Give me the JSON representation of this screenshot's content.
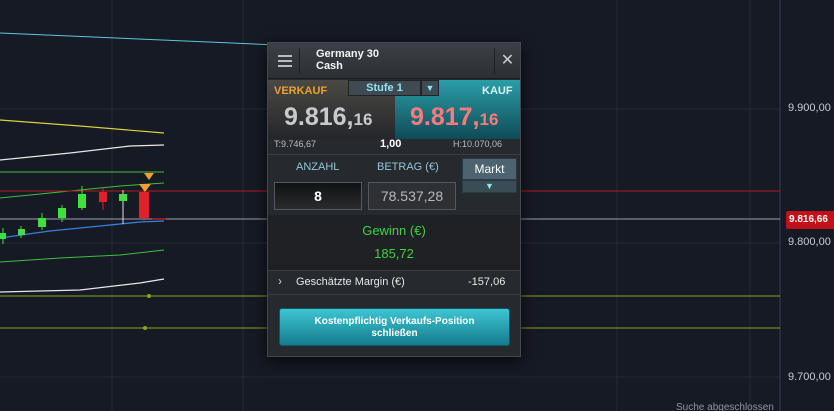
{
  "axis": {
    "labels": [
      "9.900,00",
      "9.800,00",
      "9.700,00"
    ],
    "current_price_tag": "9.816,66"
  },
  "status": {
    "market_closed_note": "Suche abgeschlossen"
  },
  "colors": {
    "background": "#161a24",
    "sell_label": "#f0a030",
    "buy_price": "#ff7b7b",
    "buy_panel": "#1e8a96",
    "gain": "#3ed43e",
    "price_tag": "#c0101a",
    "action_button": "#28a9b8"
  },
  "ticket": {
    "title_line1": "Germany 30",
    "title_line2": "Cash",
    "menu_icon": "hamburger-icon",
    "close_icon": "close-icon",
    "sell_label": "VERKAUF",
    "buy_label": "KAUF",
    "level": "Stufe 1",
    "sell_price_main": "9.816,",
    "sell_price_frac": "16",
    "buy_price_main": "9.817,",
    "buy_price_frac": "16",
    "low": "T:9.746,67",
    "spread": "1,00",
    "high": "H:10.070,06",
    "quantity_label": "ANZAHL",
    "amount_label": "BETRAG (€)",
    "order_type": "Markt",
    "quantity": "8",
    "amount": "78.537,28",
    "gain_label": "Gewinn (€)",
    "gain_value": "185,72",
    "margin_label": "Geschätzte Margin (€)",
    "margin_value": "-157,06",
    "action_line1": "Kostenpflichtig Verkaufs-Position",
    "action_line2": "schließen"
  }
}
